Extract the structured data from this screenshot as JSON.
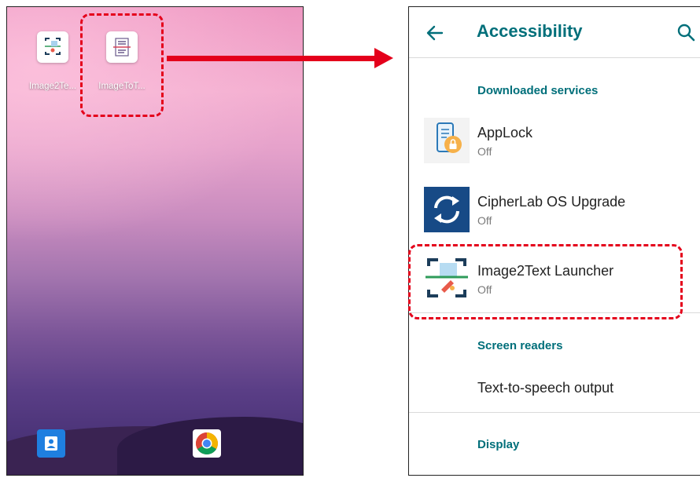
{
  "home": {
    "apps": [
      {
        "label": "Image2Te...",
        "icon": "image2text-app-icon"
      },
      {
        "label": "ImageToT...",
        "icon": "imagetotext-app-icon"
      }
    ],
    "dock": [
      {
        "icon": "contacts-icon"
      },
      {
        "icon": "chrome-icon"
      }
    ]
  },
  "settings": {
    "title": "Accessibility",
    "sections": {
      "downloaded": "Downloaded services",
      "screen_readers": "Screen readers",
      "display": "Display"
    },
    "services": [
      {
        "name": "AppLock",
        "status": "Off",
        "icon": "applock-icon"
      },
      {
        "name": "CipherLab OS Upgrade",
        "status": "Off",
        "icon": "os-upgrade-icon"
      },
      {
        "name": "Image2Text Launcher",
        "status": "Off",
        "icon": "image2text-launcher-icon"
      }
    ],
    "screen_reader_items": [
      {
        "name": "Text-to-speech output"
      }
    ]
  },
  "colors": {
    "accent": "#006f7a",
    "highlight": "#e4001b"
  }
}
